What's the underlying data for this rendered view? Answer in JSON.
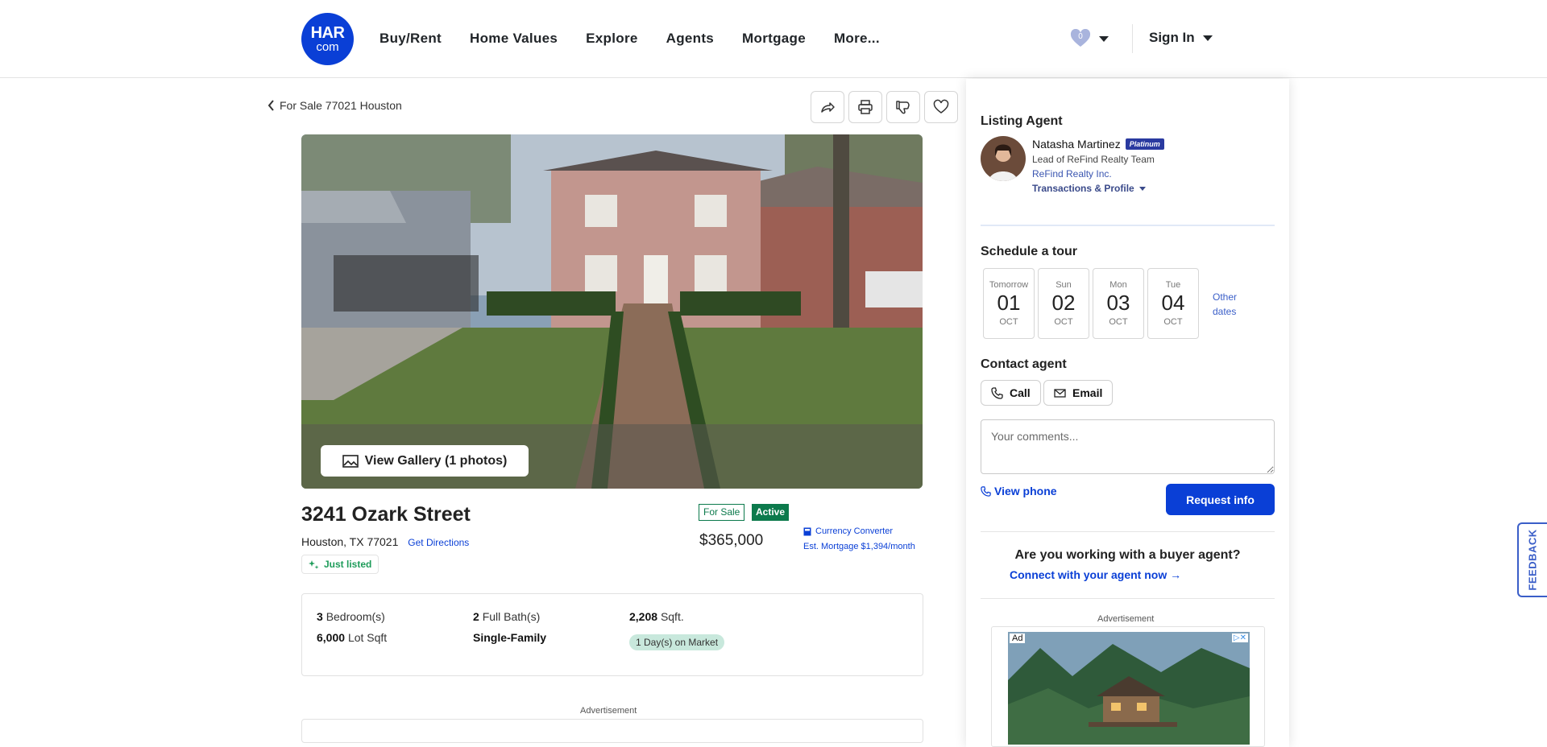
{
  "header": {
    "logo": {
      "line1": "HAR",
      "line2": "com"
    },
    "nav": [
      "Buy/Rent",
      "Home Values",
      "Explore",
      "Agents",
      "Mortgage",
      "More..."
    ],
    "favorites_count": "0",
    "sign_in": "Sign In"
  },
  "breadcrumb": {
    "back_label": "For Sale 77021 Houston"
  },
  "gallery": {
    "button_label": "View Gallery (1 photos)"
  },
  "listing": {
    "street": "3241 Ozark Street",
    "city_line": "Houston, TX 77021",
    "directions": "Get Directions",
    "just_listed": "Just listed",
    "status_sale": "For Sale",
    "status_active": "Active",
    "price": "$365,000",
    "currency_converter": "Currency Converter",
    "est_mortgage": "Est. Mortgage $1,394/month"
  },
  "facts": {
    "bedrooms_num": "3",
    "bedrooms_label": "Bedroom(s)",
    "baths_num": "2",
    "baths_label": "Full Bath(s)",
    "sqft_num": "2,208",
    "sqft_label": "Sqft.",
    "lot_num": "6,000",
    "lot_label": "Lot Sqft",
    "type": "Single-Family",
    "days_on_market": "1 Day(s) on Market"
  },
  "ads": {
    "label": "Advertisement",
    "tag": "Ad",
    "close": "▷✕"
  },
  "agent_panel": {
    "listing_agent_title": "Listing Agent",
    "agent_name": "Natasha Martinez",
    "agent_badge": "Platinum",
    "agent_role": "Lead of ReFind Realty Team",
    "agent_company": "ReFind Realty Inc.",
    "transactions_link": "Transactions & Profile",
    "schedule_title": "Schedule a tour",
    "days": [
      {
        "name": "Tomorrow",
        "date": "01",
        "month": "OCT"
      },
      {
        "name": "Sun",
        "date": "02",
        "month": "OCT"
      },
      {
        "name": "Mon",
        "date": "03",
        "month": "OCT"
      },
      {
        "name": "Tue",
        "date": "04",
        "month": "OCT"
      }
    ],
    "other_dates": "Other dates",
    "contact_title": "Contact agent",
    "call_label": "Call",
    "email_label": "Email",
    "comments_placeholder": "Your comments...",
    "view_phone": "View phone",
    "request_info": "Request info",
    "buyer_question": "Are you working with a buyer agent?",
    "buyer_link": "Connect with your agent now →"
  },
  "feedback_label": "FEEDBACK",
  "colors": {
    "brand": "#0a3fd6",
    "active_green": "#0c7a4c",
    "link": "#3a5ec8"
  }
}
